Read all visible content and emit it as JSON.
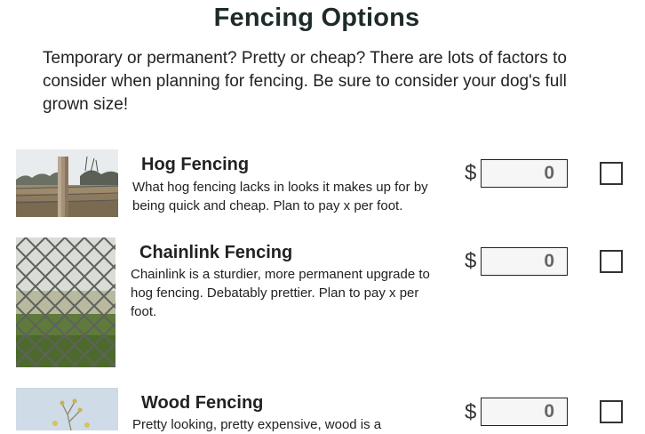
{
  "page": {
    "title": "Fencing Options",
    "intro": "Temporary or permanent? Pretty or cheap? There are lots of factors to consider when planning for fencing. Be sure to consider your dog's full grown size!"
  },
  "options": [
    {
      "title": "Hog Fencing",
      "description": "What hog fencing lacks in looks it makes up for by being quick and cheap. Plan to pay x per foot.",
      "currency": "$",
      "price": "0",
      "checked": false
    },
    {
      "title": "Chainlink Fencing",
      "description": "Chainlink is a sturdier, more permanent upgrade to hog fencing. Debatably prettier. Plan to pay x per foot.",
      "currency": "$",
      "price": "0",
      "checked": false
    },
    {
      "title": "Wood Fencing",
      "description": "Pretty looking, pretty expensive, wood is a",
      "currency": "$",
      "price": "0",
      "checked": false
    }
  ]
}
